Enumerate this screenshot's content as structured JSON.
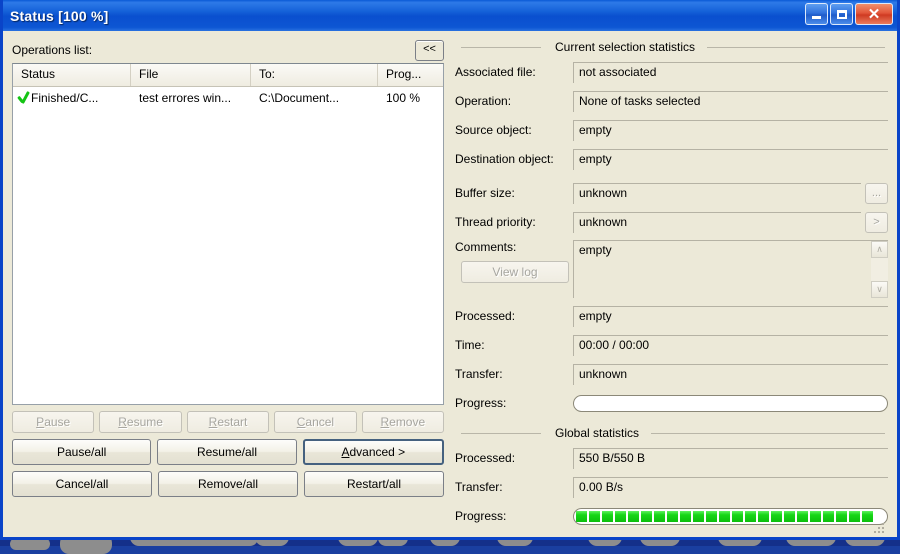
{
  "window": {
    "title": "Status [100 %]",
    "minimize_label": "Minimize",
    "maximize_label": "Maximize",
    "close_label": "Close",
    "close_glyph": "✕"
  },
  "operations": {
    "label": "Operations list:",
    "collapse_label": "<<",
    "columns": [
      "Status",
      "File",
      "To:",
      "Prog..."
    ],
    "rows": [
      {
        "status": "Finished/C...",
        "file": "test errores win...",
        "to": "C:\\Document...",
        "progress": "100 %",
        "icon": "green-check-icon"
      }
    ]
  },
  "item_buttons": [
    {
      "label": "Pause",
      "accel": "P",
      "enabled": false
    },
    {
      "label": "Resume",
      "accel": "R",
      "enabled": false
    },
    {
      "label": "Restart",
      "accel": "R",
      "enabled": false
    },
    {
      "label": "Cancel",
      "accel": "C",
      "enabled": false
    },
    {
      "label": "Remove",
      "accel": "R",
      "enabled": false
    }
  ],
  "all_buttons_row1": [
    {
      "label": "Pause/all",
      "enabled": true,
      "default": false
    },
    {
      "label": "Resume/all",
      "enabled": true,
      "default": false
    },
    {
      "label": "Advanced >",
      "accel": "A",
      "enabled": true,
      "default": true
    }
  ],
  "all_buttons_row2": [
    {
      "label": "Cancel/all",
      "enabled": true,
      "default": false
    },
    {
      "label": "Remove/all",
      "enabled": true,
      "default": false
    },
    {
      "label": "Restart/all",
      "enabled": true,
      "default": false
    }
  ],
  "selection": {
    "group_title": "Current selection statistics",
    "fields": [
      {
        "label": "Associated file:",
        "value": "not associated"
      },
      {
        "label": "Operation:",
        "value": "None of tasks selected"
      },
      {
        "label": "Source object:",
        "value": "empty"
      },
      {
        "label": "Destination object:",
        "value": "empty"
      },
      {
        "label": "Buffer size:",
        "value": "unknown",
        "button": "...",
        "button_enabled": false
      },
      {
        "label": "Thread priority:",
        "value": "unknown",
        "button": ">",
        "button_enabled": false
      }
    ],
    "comments": {
      "label": "Comments:",
      "value": "empty",
      "view_log_label": "View log",
      "view_log_enabled": false,
      "scroll_up": "∧",
      "scroll_down": "∨"
    },
    "tail_fields": [
      {
        "label": "Processed:",
        "value": "empty"
      },
      {
        "label": "Time:",
        "value": "00:00 / 00:00"
      },
      {
        "label": "Transfer:",
        "value": "unknown"
      }
    ],
    "progress": {
      "label": "Progress:",
      "percent": 0,
      "segments": 0
    }
  },
  "global": {
    "group_title": "Global statistics",
    "fields": [
      {
        "label": "Processed:",
        "value": "550 B/550 B"
      },
      {
        "label": "Transfer:",
        "value": "0.00 B/s"
      }
    ],
    "progress": {
      "label": "Progress:",
      "percent": 100,
      "segments": 23
    }
  },
  "colors": {
    "titlebar_blue": "#0a4fcf",
    "dialog_face": "#ece9d8",
    "progress_green": "#17d617",
    "check_green": "#14c414",
    "desktop_blue": "#1c3fa6"
  }
}
